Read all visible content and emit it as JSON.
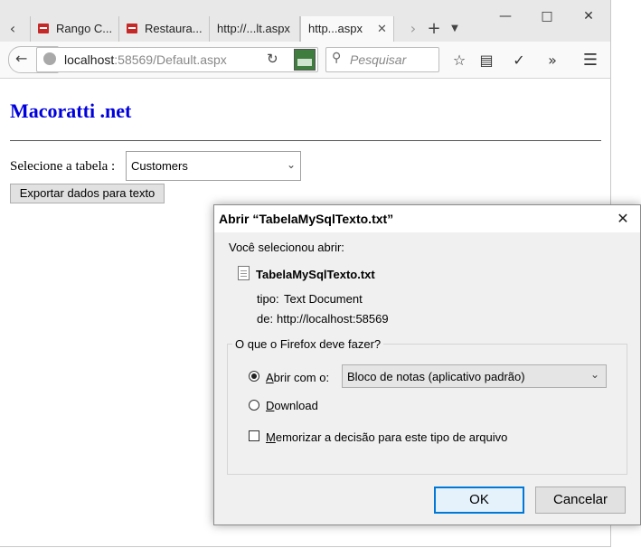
{
  "browser": {
    "tabs": [
      {
        "label": "Rango C...",
        "has_favicon": true
      },
      {
        "label": "Restaura...",
        "has_favicon": true
      },
      {
        "label": "http://...lt.aspx",
        "has_favicon": false
      },
      {
        "label": "http...aspx",
        "has_favicon": false,
        "active": true
      }
    ],
    "url_host": "localhost",
    "url_rest": ":58569/Default.aspx",
    "search_placeholder": "Pesquisar",
    "icons": [
      "back-icon",
      "reload-icon",
      "bookmark-star-icon",
      "reading-list-icon",
      "pocket-icon",
      "overflow-icon",
      "menu-icon"
    ]
  },
  "page": {
    "heading": "Macoratti .net",
    "select_label": "Selecione a tabela :",
    "select_value": "Customers",
    "export_button": "Exportar dados para texto"
  },
  "dialog": {
    "title": "Abrir “TabelaMySqlTexto.txt”",
    "intro": "Você selecionou abrir:",
    "filename": "TabelaMySqlTexto.txt",
    "type_label": "tipo:",
    "type_value": "Text Document",
    "from_label": "de:",
    "from_value": "http://localhost:58569",
    "group_title": "O que o Firefox deve fazer?",
    "option_open_prefix": "A",
    "option_open_rest": "brir com o:",
    "option_open_selected": true,
    "app_value": "Bloco de notas (aplicativo padrão)",
    "option_download_prefix": "D",
    "option_download_rest": "ownload",
    "remember_prefix": "M",
    "remember_rest": "emorizar a decisão para este tipo de arquivo",
    "ok": "OK",
    "cancel": "Cancelar"
  }
}
